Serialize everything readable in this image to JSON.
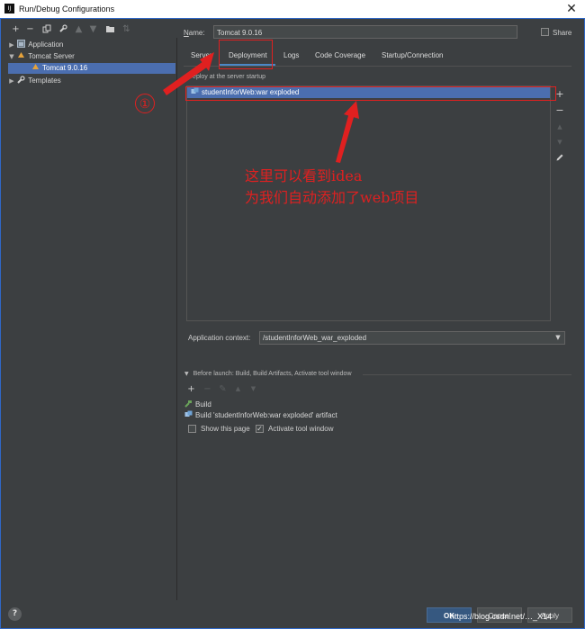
{
  "window": {
    "title": "Run/Debug Configurations",
    "app_icon_text": "IJ"
  },
  "toolbar": {
    "items": [
      "plus-icon",
      "minus-icon",
      "copy-icon",
      "wrench-icon",
      "arrow-up-icon",
      "arrow-down-icon",
      "folder-icon",
      "sort-icon"
    ]
  },
  "tree": {
    "items": [
      {
        "label": "Application",
        "expanded": false
      },
      {
        "label": "Tomcat Server",
        "expanded": true
      },
      {
        "label": "Tomcat 9.0.16",
        "selected": true
      },
      {
        "label": "Templates",
        "expanded": false
      }
    ]
  },
  "form": {
    "name_label_underlined": "N",
    "name_label_rest": "ame:",
    "name_value": "Tomcat 9.0.16",
    "share_label": "Share"
  },
  "tabs": {
    "items": [
      "Server",
      "Deployment",
      "Logs",
      "Code Coverage",
      "Startup/Connection"
    ],
    "active": "Deployment"
  },
  "deployment": {
    "header": "Deploy at the server startup",
    "items": [
      "studentInforWeb:war exploded"
    ],
    "context_label": "Application context:",
    "context_value": "/studentInforWeb_war_exploded"
  },
  "before_launch": {
    "header": "Before launch: Build, Build Artifacts, Activate tool window",
    "items": [
      "Build",
      "Build 'studentInforWeb:war exploded' artifact"
    ],
    "show_page_label": "Show this page",
    "show_page_checked": false,
    "activate_label": "Activate tool window",
    "activate_checked": true
  },
  "footer": {
    "help": "?",
    "ok": "OK",
    "cancel": "Cancel",
    "apply": "Apply"
  },
  "annotations": {
    "circle_number": "①",
    "text_line1": "这里可以看到idea",
    "text_line2": "为我们自动添加了web项目",
    "color": "#e02020"
  },
  "watermark": "https://blog.csdn.net/…_X14"
}
